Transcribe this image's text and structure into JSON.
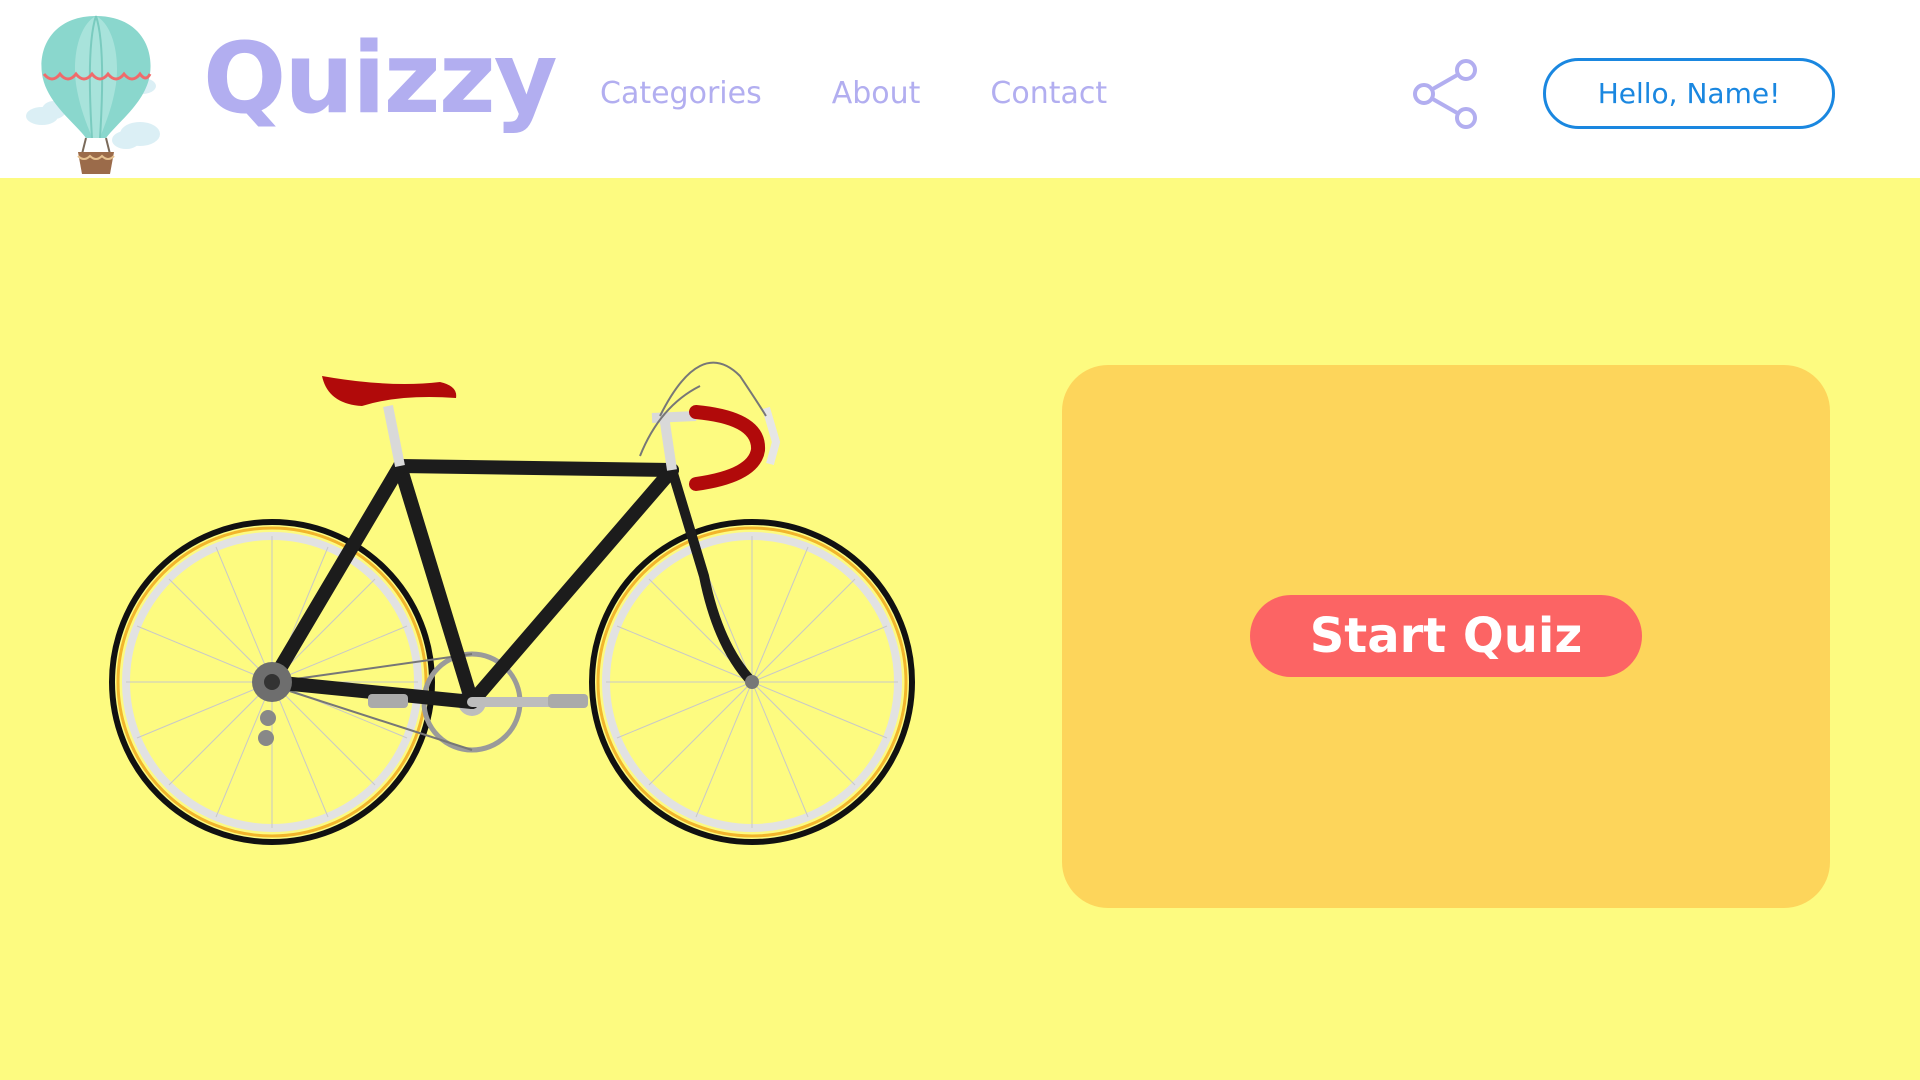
{
  "brand": {
    "name": "Quizzy",
    "logo_icon": "hot-air-balloon-icon"
  },
  "nav": {
    "items": [
      {
        "label": "Categories"
      },
      {
        "label": "About"
      },
      {
        "label": "Contact"
      }
    ]
  },
  "header": {
    "share_icon": "share-icon",
    "greeting_button_label": "Hello, Name!"
  },
  "hero": {
    "illustration": "bicycle-illustration",
    "start_button_label": "Start Quiz"
  },
  "colors": {
    "brand_lavender": "#b2aef0",
    "accent_blue": "#1a87e0",
    "background_yellow": "#fdfb80",
    "card_orange": "#fdd55b",
    "button_red": "#fc6464"
  }
}
